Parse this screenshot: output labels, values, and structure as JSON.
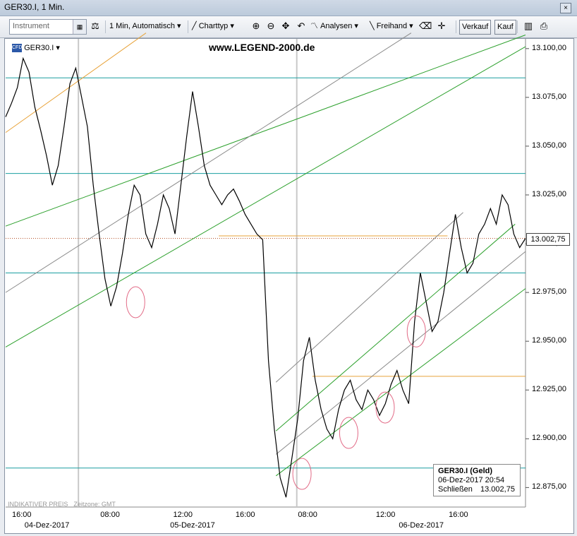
{
  "window": {
    "title": "GER30.I, 1 Min.",
    "close_glyph": "×"
  },
  "toolbar": {
    "instrument_placeholder": "Instrument",
    "interval": "1 Min,",
    "mode": "Automatisch",
    "charttype": "Charttyp",
    "analysen": "Analysen",
    "freihand": "Freihand",
    "verkauf": "Verkauf",
    "kauf": "Kauf"
  },
  "chart_header": {
    "cfd_badge": "CFD",
    "symbol": "GER30.I",
    "watermark": "www.LEGEND-2000.de"
  },
  "legend_box": {
    "title": "GER30.I (Geld)",
    "datetime": "06-Dez-2017 20:54",
    "close_label": "Schließen",
    "close_value": "13.002,75"
  },
  "footer": {
    "indicative": "INDIKATIVER PREIS",
    "timezone": "Zeitzone: GMT"
  },
  "colors": {
    "price": "#000000",
    "teal": "#1a9ea0",
    "green": "#2ca02c",
    "gray": "#8a8a8a",
    "orange": "#e8a33a",
    "circle": "#e26a86"
  },
  "chart_data": {
    "type": "line",
    "ylim": [
      12865,
      13105
    ],
    "yticks": [
      "13.100,00",
      "13.075,00",
      "13.050,00",
      "13.025,00",
      "13.000,00",
      "12.975,00",
      "12.950,00",
      "12.925,00",
      "12.900,00",
      "12.875,00"
    ],
    "ytick_values": [
      13100,
      13075,
      13050,
      13025,
      13000,
      12975,
      12950,
      12925,
      12900,
      12875
    ],
    "last_price": {
      "value": 13002.75,
      "label": "13.002,75"
    },
    "xticks": [
      "16:00",
      "08:00",
      "12:00",
      "16:00",
      "08:00",
      "12:00",
      "16:00"
    ],
    "xtick_pos": [
      0.0,
      0.17,
      0.31,
      0.43,
      0.55,
      0.7,
      0.84
    ],
    "dates": [
      "04-Dez-2017",
      "05-Dez-2017",
      "06-Dez-2017"
    ],
    "date_pos": [
      0.02,
      0.3,
      0.74
    ],
    "series": [
      {
        "values": [
          13065,
          13072,
          13080,
          13095,
          13088,
          13070,
          13058,
          13045,
          13030,
          13040,
          13060,
          13082,
          13090,
          13075,
          13060,
          13030,
          13005,
          12982,
          12968,
          12978,
          12995,
          13015,
          13030,
          13025,
          13005,
          12998,
          13010,
          13025,
          13018,
          13005,
          13030,
          13055,
          13078,
          13060,
          13040,
          13030,
          13025,
          13020,
          13025,
          13028,
          13022,
          13015,
          13010,
          13005,
          13002,
          12940,
          12905,
          12880,
          12870,
          12890,
          12910,
          12940,
          12952,
          12930,
          12915,
          12905,
          12900,
          12915,
          12925,
          12930,
          12920,
          12915,
          12925,
          12920,
          12912,
          12918,
          12928,
          12935,
          12925,
          12918,
          12960,
          12985,
          12970,
          12955,
          12960,
          12975,
          12995,
          13015,
          12998,
          12985,
          12990,
          13005,
          13010,
          13018,
          13010,
          13025,
          13020,
          13005,
          12998,
          13002.75
        ]
      }
    ],
    "hlines": [
      13085,
      13036,
      12985,
      12885
    ],
    "orange_hlines": [
      [
        0.41,
        0.85,
        13004
      ],
      [
        0.59,
        1.0,
        12932
      ]
    ],
    "trend_lines": [
      {
        "color": "green",
        "x1": 0.0,
        "y1": 13009,
        "x2": 1.0,
        "y2": 13107
      },
      {
        "color": "green",
        "x1": 0.0,
        "y1": 12947,
        "x2": 1.0,
        "y2": 13101
      },
      {
        "color": "green",
        "x1": 0.52,
        "y1": 12881,
        "x2": 1.0,
        "y2": 12977
      },
      {
        "color": "green",
        "x1": 0.52,
        "y1": 12904,
        "x2": 0.98,
        "y2": 13010
      },
      {
        "color": "gray",
        "x1": 0.0,
        "y1": 12975,
        "x2": 0.78,
        "y2": 13108
      },
      {
        "color": "gray",
        "x1": 0.52,
        "y1": 12892,
        "x2": 1.0,
        "y2": 12996
      },
      {
        "color": "gray",
        "x1": 0.52,
        "y1": 12929,
        "x2": 0.88,
        "y2": 13016
      },
      {
        "color": "orange",
        "x1": 0.0,
        "y1": 13057,
        "x2": 0.27,
        "y2": 13108
      }
    ],
    "circles": [
      [
        0.25,
        12970
      ],
      [
        0.57,
        12882
      ],
      [
        0.66,
        12903
      ],
      [
        0.73,
        12916
      ],
      [
        0.79,
        12955
      ]
    ]
  }
}
